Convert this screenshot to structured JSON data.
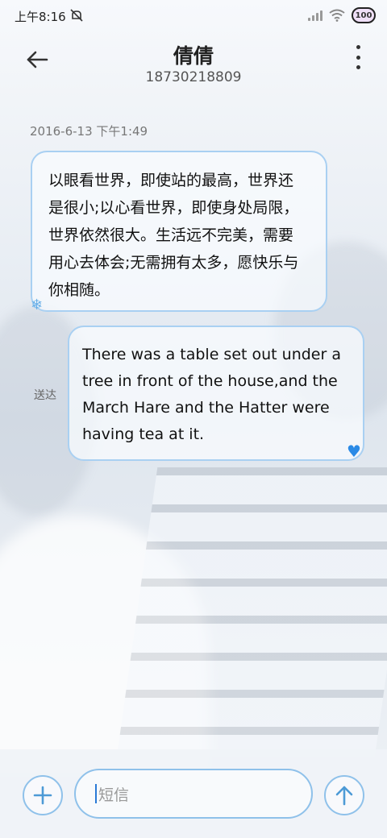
{
  "status_bar": {
    "time": "上午8:16",
    "battery_text": "100"
  },
  "header": {
    "contact_name": "倩倩",
    "contact_number": "18730218809"
  },
  "conversation": {
    "timestamp": "2016-6-13 下午1:49",
    "messages": [
      {
        "direction": "incoming",
        "lines": [
          "以眼看世界，即使站的最高，世界还",
          "是很小;以心看世界，即使身处局限，",
          "世界依然很大。生活远不完美，需要",
          "用心去体会;无需拥有太多，愿快乐与",
          "你相随。"
        ]
      },
      {
        "direction": "outgoing",
        "status": "送达",
        "lines": [
          "There was a table set out under a",
          "tree in front of the house,and the",
          "March Hare and the Hatter were",
          "having tea at it."
        ]
      }
    ]
  },
  "composer": {
    "placeholder": "短信"
  },
  "icons": {
    "back": "back-arrow-icon",
    "more": "more-vertical-icon",
    "mute": "mute-icon",
    "signal": "signal-icon",
    "wifi": "wifi-icon",
    "battery": "battery-icon",
    "snowflake": "snowflake-icon",
    "heart": "blue-heart-icon",
    "add": "plus-icon",
    "send": "send-arrow-icon"
  },
  "colors": {
    "accent": "#8fc1ea",
    "bubble_border": "#a9d0f2"
  }
}
